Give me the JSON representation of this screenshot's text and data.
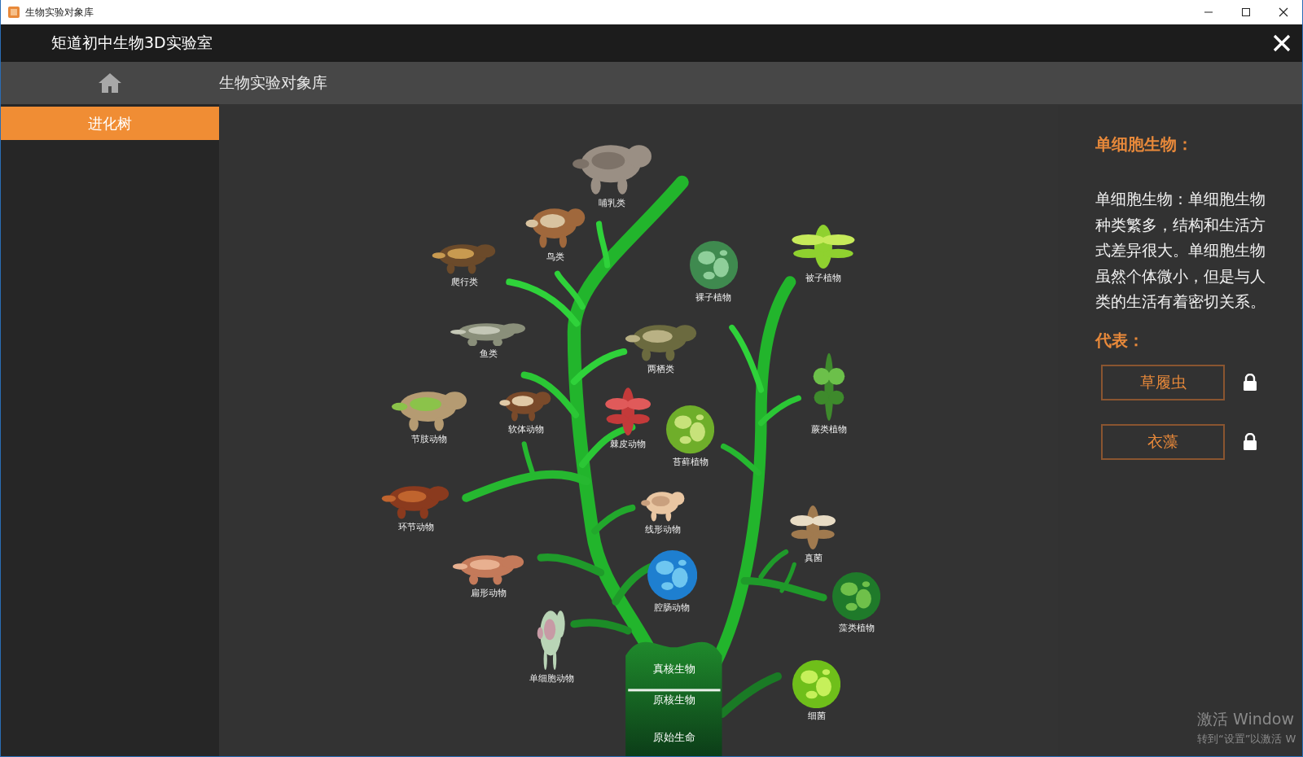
{
  "window": {
    "title": "生物实验对象库"
  },
  "app": {
    "title": "矩道初中生物3D实验室"
  },
  "nav": {
    "title": "生物实验对象库"
  },
  "sidebar": {
    "items": [
      {
        "label": "进化树",
        "selected": true
      }
    ]
  },
  "tree": {
    "organisms": [
      {
        "label": "哺乳类"
      },
      {
        "label": "鸟类"
      },
      {
        "label": "爬行类"
      },
      {
        "label": "鱼类"
      },
      {
        "label": "两栖类"
      },
      {
        "label": "裸子植物"
      },
      {
        "label": "被子植物"
      },
      {
        "label": "节肢动物"
      },
      {
        "label": "软体动物"
      },
      {
        "label": "棘皮动物"
      },
      {
        "label": "苔藓植物"
      },
      {
        "label": "蕨类植物"
      },
      {
        "label": "环节动物"
      },
      {
        "label": "线形动物"
      },
      {
        "label": "真菌"
      },
      {
        "label": "扁形动物"
      },
      {
        "label": "腔肠动物"
      },
      {
        "label": "藻类植物"
      },
      {
        "label": "单细胞动物"
      },
      {
        "label": "细菌"
      }
    ],
    "trunk_labels": [
      "真核生物",
      "原核生物",
      "原始生命"
    ]
  },
  "info": {
    "heading": "单细胞生物：",
    "description": "单细胞生物：单细胞生物种类繁多，结构和生活方式差异很大。单细胞生物虽然个体微小，但是与人类的生活有着密切关系。",
    "representatives_heading": "代表：",
    "representatives": [
      {
        "label": "草履虫",
        "locked": true
      },
      {
        "label": "衣藻",
        "locked": true
      }
    ]
  },
  "system_overlay": [
    "激活 Window",
    "转到“设置”以激活 W"
  ]
}
